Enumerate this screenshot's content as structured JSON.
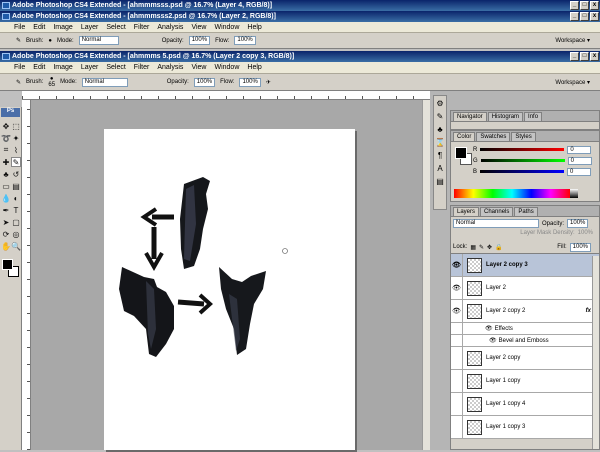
{
  "windows": [
    {
      "title": "Adobe Photoshop CS4 Extended - [ahmmmsss.psd @ 16.7% (Layer 4, RGB/8)]"
    },
    {
      "title": "Adobe Photoshop CS4 Extended - [ahmmmsss2.psd @ 16.7% (Layer 2, RGB/8)]"
    },
    {
      "title": "Adobe Photoshop CS4 Extended - [ahmmms 5.psd @ 16.7% (Layer 2 copy 3, RGB/8)]"
    }
  ],
  "menu": [
    "File",
    "Edit",
    "Image",
    "Layer",
    "Select",
    "Filter",
    "Analysis",
    "View",
    "Window",
    "Help"
  ],
  "options": {
    "brush_label": "Brush:",
    "brush_size": "65",
    "mode_label": "Mode:",
    "mode_value": "Normal",
    "opacity_label": "Opacity:",
    "opacity_value": "100%",
    "flow_label": "Flow:",
    "flow_value": "100%",
    "workspace": "Workspace ▾"
  },
  "panels": {
    "top_tabs": [
      "Navigator",
      "Histogram",
      "Info"
    ],
    "color_tabs": [
      "Color",
      "Swatches",
      "Styles"
    ],
    "color": {
      "r_label": "R",
      "g_label": "G",
      "b_label": "B",
      "r": "0",
      "g": "0",
      "b": "0"
    },
    "layer_tabs": [
      "Layers",
      "Channels",
      "Paths"
    ],
    "blend_mode": "Normal",
    "opacity_label": "Opacity:",
    "opacity_value": "100%",
    "mask_density_label": "Layer Mask Density:",
    "mask_density_value": "100%",
    "lock_label": "Lock:",
    "fill_label": "Fill:",
    "fill_value": "100%"
  },
  "layers": [
    {
      "name": "Layer 2 copy 3",
      "visible": true,
      "selected": true
    },
    {
      "name": "Layer 2",
      "visible": true,
      "selected": false
    },
    {
      "name": "Layer 2 copy 2",
      "visible": true,
      "selected": false,
      "fx": "fx"
    },
    {
      "name": "Effects",
      "sub": true
    },
    {
      "name": "Bevel and Emboss",
      "sub": true
    },
    {
      "name": "Layer 2 copy",
      "visible": false,
      "selected": false
    },
    {
      "name": "Layer 1 copy",
      "visible": false,
      "selected": false
    },
    {
      "name": "Layer 1 copy 4",
      "visible": false,
      "selected": false
    },
    {
      "name": "Layer 1 copy 3",
      "visible": false,
      "selected": false
    }
  ],
  "colors": {
    "accent": "#0a246a",
    "selected_layer": "#b8c4d8"
  }
}
